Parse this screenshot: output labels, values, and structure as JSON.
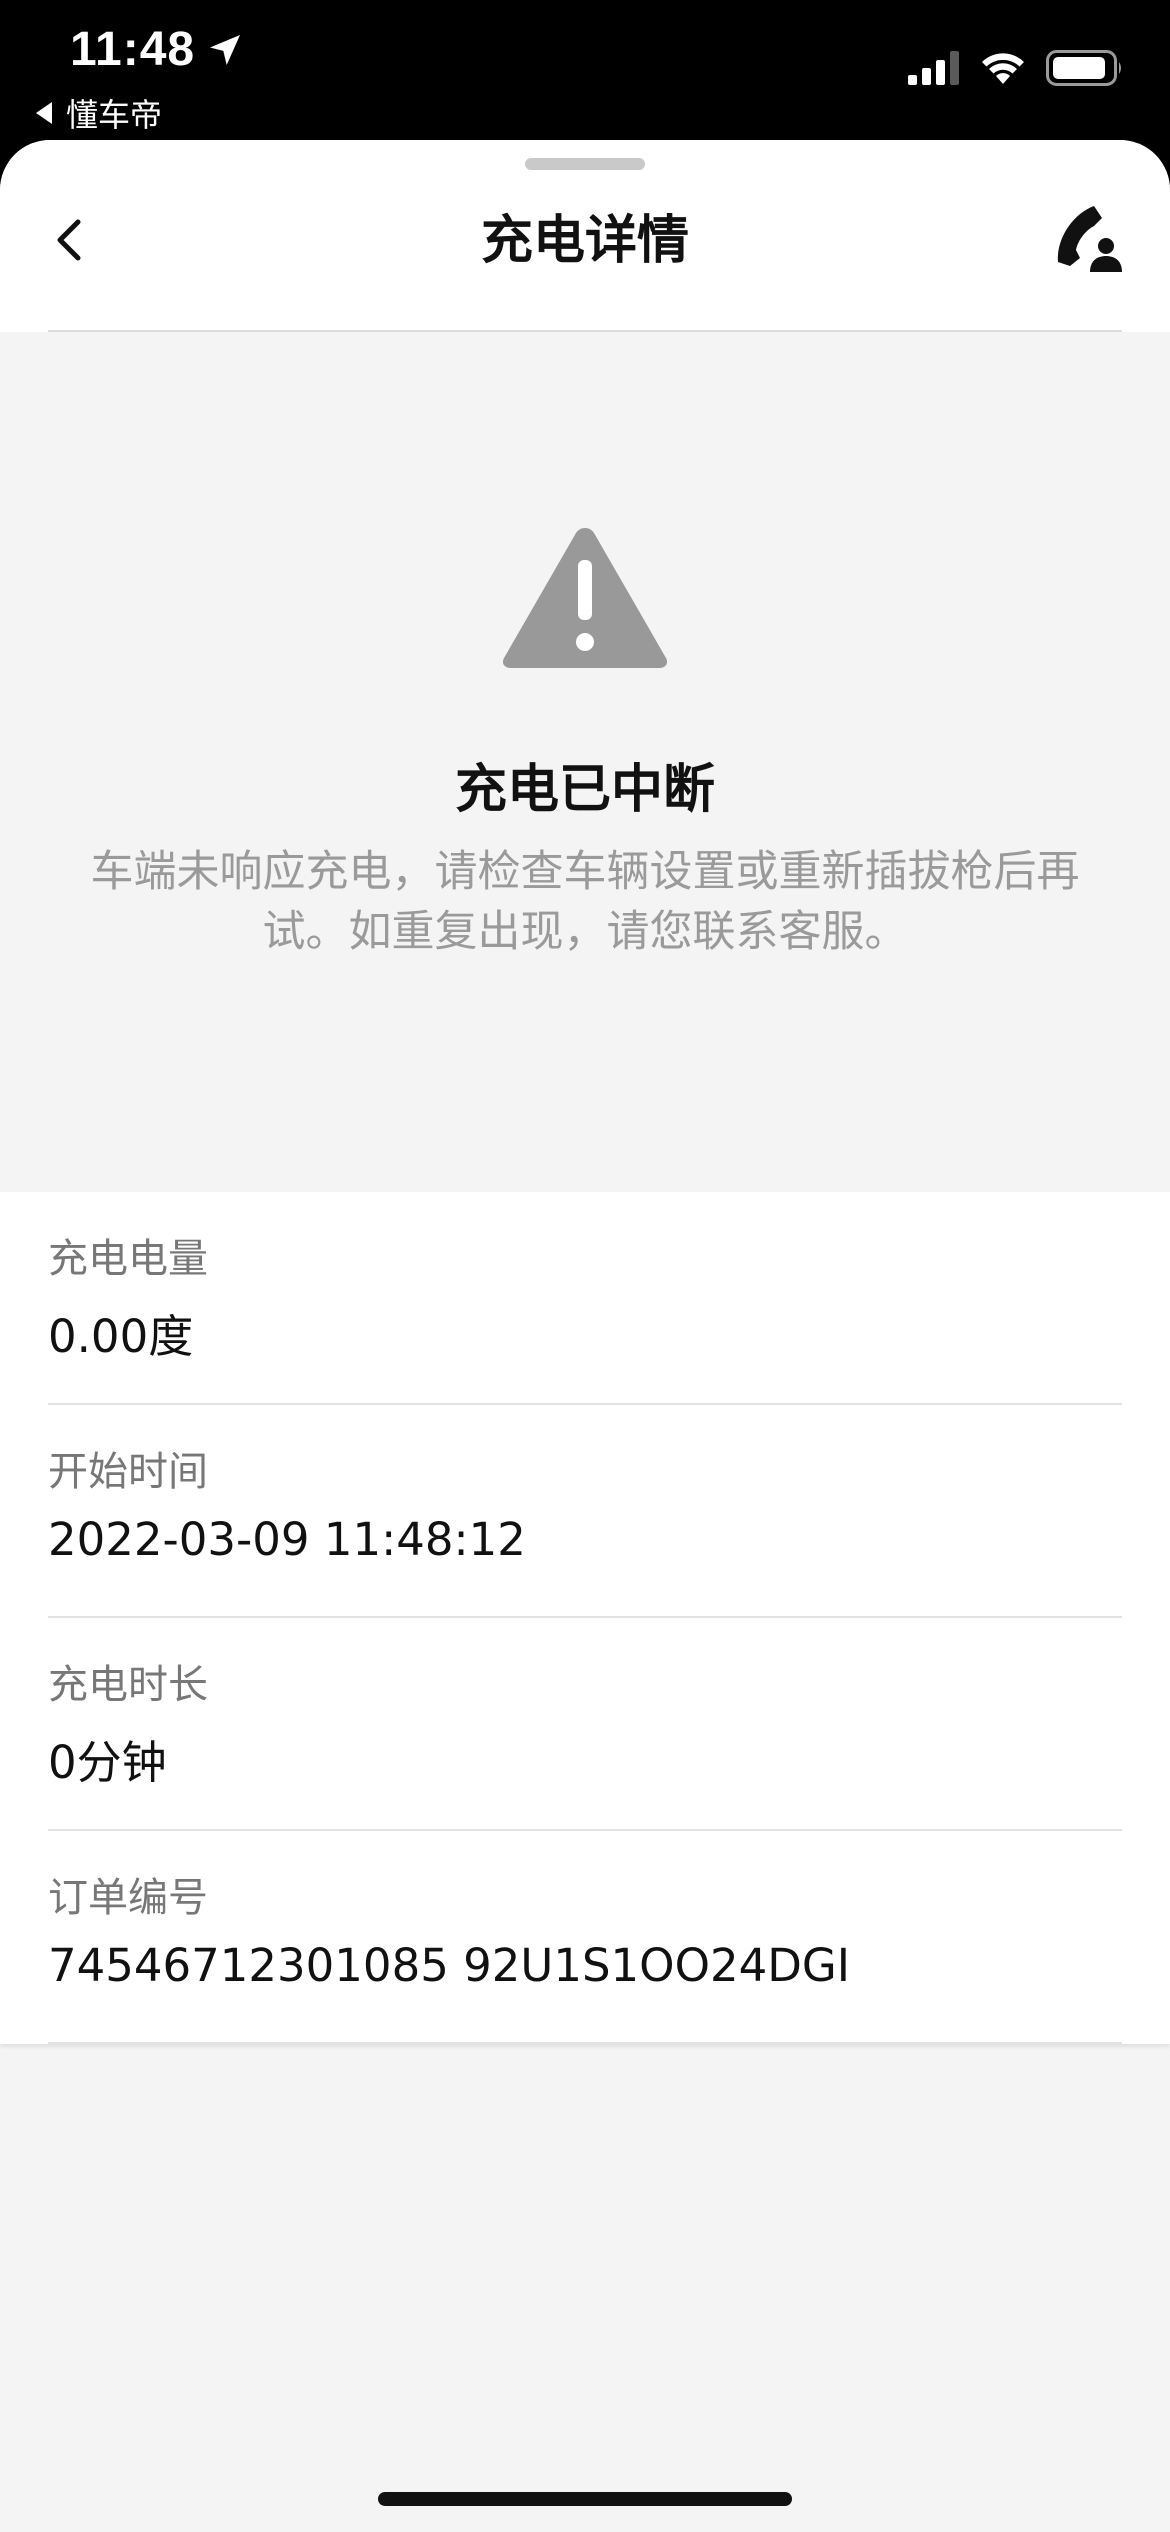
{
  "status_bar": {
    "time": "11:48",
    "back_app": "懂车帝"
  },
  "header": {
    "title": "充电详情"
  },
  "charge_status": {
    "title": "充电已中断",
    "description": "车端未响应充电，请检查车辆设置或重新插拔枪后再试。如重复出现，请您联系客服。"
  },
  "details": [
    {
      "label": "充电电量",
      "value": "0.00度"
    },
    {
      "label": "开始时间",
      "value": "2022-03-09 11:48:12"
    },
    {
      "label": "充电时长",
      "value": "0分钟"
    },
    {
      "label": "订单编号",
      "value": "74546712301085 92U1S1OO24DGI"
    }
  ],
  "colors": {
    "warning_icon": "#999999",
    "background": "#f4f4f4",
    "card": "#ffffff",
    "text_secondary": "#9a9a9a"
  },
  "icons": {
    "back": "chevron-left-icon",
    "customer_service": "phone-support-icon",
    "warning": "warning-triangle-icon"
  }
}
